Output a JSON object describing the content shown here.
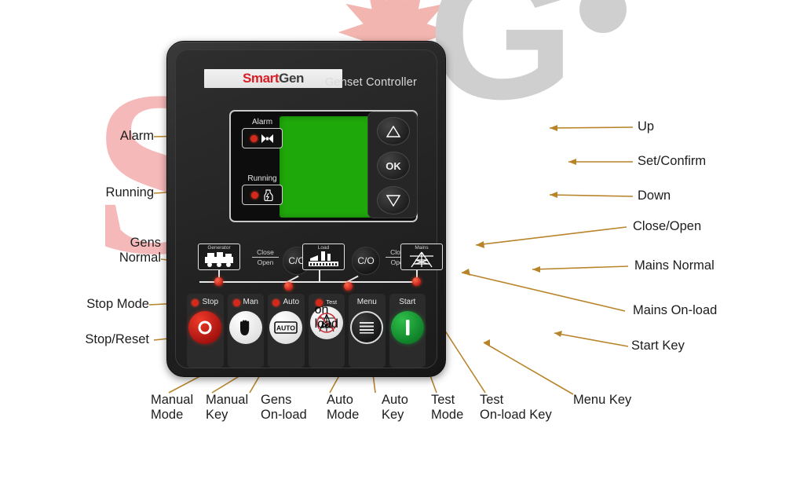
{
  "watermark": {
    "s": "S",
    "star": "✹",
    "g": "G"
  },
  "device": {
    "brand_first": "Smart",
    "brand_second": "Gen",
    "title": "Genset Controller",
    "indicators": [
      {
        "name": "alarm",
        "label": "Alarm",
        "icon": "bell-alarm-icon"
      },
      {
        "name": "running",
        "label": "Running",
        "icon": "engine-running-icon"
      }
    ],
    "nav_keys": [
      {
        "name": "up",
        "label": "△",
        "icon": "triangle-up-icon"
      },
      {
        "name": "ok",
        "label": "OK",
        "icon": "ok-icon"
      },
      {
        "name": "down",
        "label": "▽",
        "icon": "triangle-down-icon"
      }
    ],
    "flow": {
      "generator_label": "Generator",
      "load_label": "Load",
      "mains_label": "Mains",
      "co_label": "C/O",
      "close_label": "Close",
      "open_label": "Open"
    },
    "buttons": [
      {
        "name": "stop",
        "label": "Stop",
        "label2": "",
        "led": true,
        "icon": "stop-ring-icon",
        "style": "b-stop"
      },
      {
        "name": "man",
        "label": "Man",
        "label2": "",
        "led": true,
        "icon": "hand-icon",
        "style": "b-white"
      },
      {
        "name": "auto",
        "label": "Auto",
        "label2": "",
        "led": true,
        "icon": "auto-plate-icon",
        "style": "b-white"
      },
      {
        "name": "test",
        "label": "Test",
        "label2": "on load",
        "led": true,
        "icon": "test-pylon-icon",
        "style": "b-white"
      },
      {
        "name": "menu",
        "label": "Menu",
        "label2": "",
        "led": false,
        "icon": "hamburger-icon",
        "style": "b-dark"
      },
      {
        "name": "start",
        "label": "Start",
        "label2": "",
        "led": false,
        "icon": "start-bar-icon",
        "style": "b-start"
      }
    ]
  },
  "annotations": {
    "left": [
      {
        "name": "alarm",
        "text": "Alarm"
      },
      {
        "name": "running",
        "text": "Running"
      },
      {
        "name": "gens-normal",
        "text": "Gens\nNormal"
      },
      {
        "name": "stop-mode",
        "text": "Stop Mode"
      },
      {
        "name": "stop-reset",
        "text": "Stop/Reset"
      }
    ],
    "right": [
      {
        "name": "up",
        "text": "Up"
      },
      {
        "name": "set-confirm",
        "text": "Set/Confirm"
      },
      {
        "name": "down",
        "text": "Down"
      },
      {
        "name": "close-open",
        "text": "Close/Open"
      },
      {
        "name": "mains-normal",
        "text": "Mains Normal"
      },
      {
        "name": "mains-on-load",
        "text": "Mains On-load"
      },
      {
        "name": "start-key",
        "text": "Start Key"
      }
    ],
    "bottom": [
      {
        "name": "manual-mode",
        "text": "Manual\nMode"
      },
      {
        "name": "manual-key",
        "text": "Manual\nKey"
      },
      {
        "name": "gens-on-load",
        "text": "Gens\nOn-load"
      },
      {
        "name": "auto-mode",
        "text": "Auto\nMode"
      },
      {
        "name": "auto-key",
        "text": "Auto\nKey"
      },
      {
        "name": "test-mode",
        "text": "Test\nMode"
      },
      {
        "name": "test-on-load-key",
        "text": "Test\nOn-load Key"
      },
      {
        "name": "menu-key",
        "text": "Menu Key"
      }
    ]
  },
  "colors": {
    "lcd_green": "#1fa80a",
    "led_red": "#c2201a",
    "brand_red": "#d61f26",
    "start_green": "#0b7a25",
    "leader_line": "#b8842a"
  }
}
